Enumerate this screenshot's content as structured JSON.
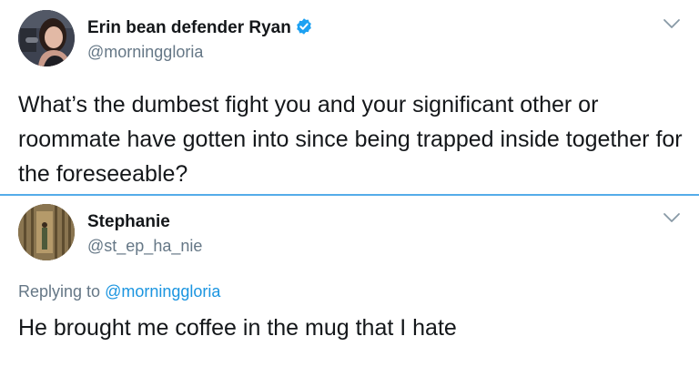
{
  "main_tweet": {
    "display_name": "Erin bean defender Ryan",
    "handle": "@morninggloria",
    "verified_icon": "verified-badge-icon",
    "menu_icon": "chevron-down-icon",
    "text": "What’s the dumbest fight you and your significant other or roommate have gotten into since being trapped inside together for the foreseeable?"
  },
  "reply_tweet": {
    "display_name": "Stephanie",
    "handle": "@st_ep_ha_nie",
    "menu_icon": "chevron-down-icon",
    "replying_prefix": "Replying to",
    "replying_to": "@morninggloria",
    "text": "He brought me coffee in the mug that I hate"
  },
  "colors": {
    "accent": "#1b95e0",
    "divider": "#55ace9",
    "secondary_text": "#657786",
    "primary_text": "#14171a"
  }
}
